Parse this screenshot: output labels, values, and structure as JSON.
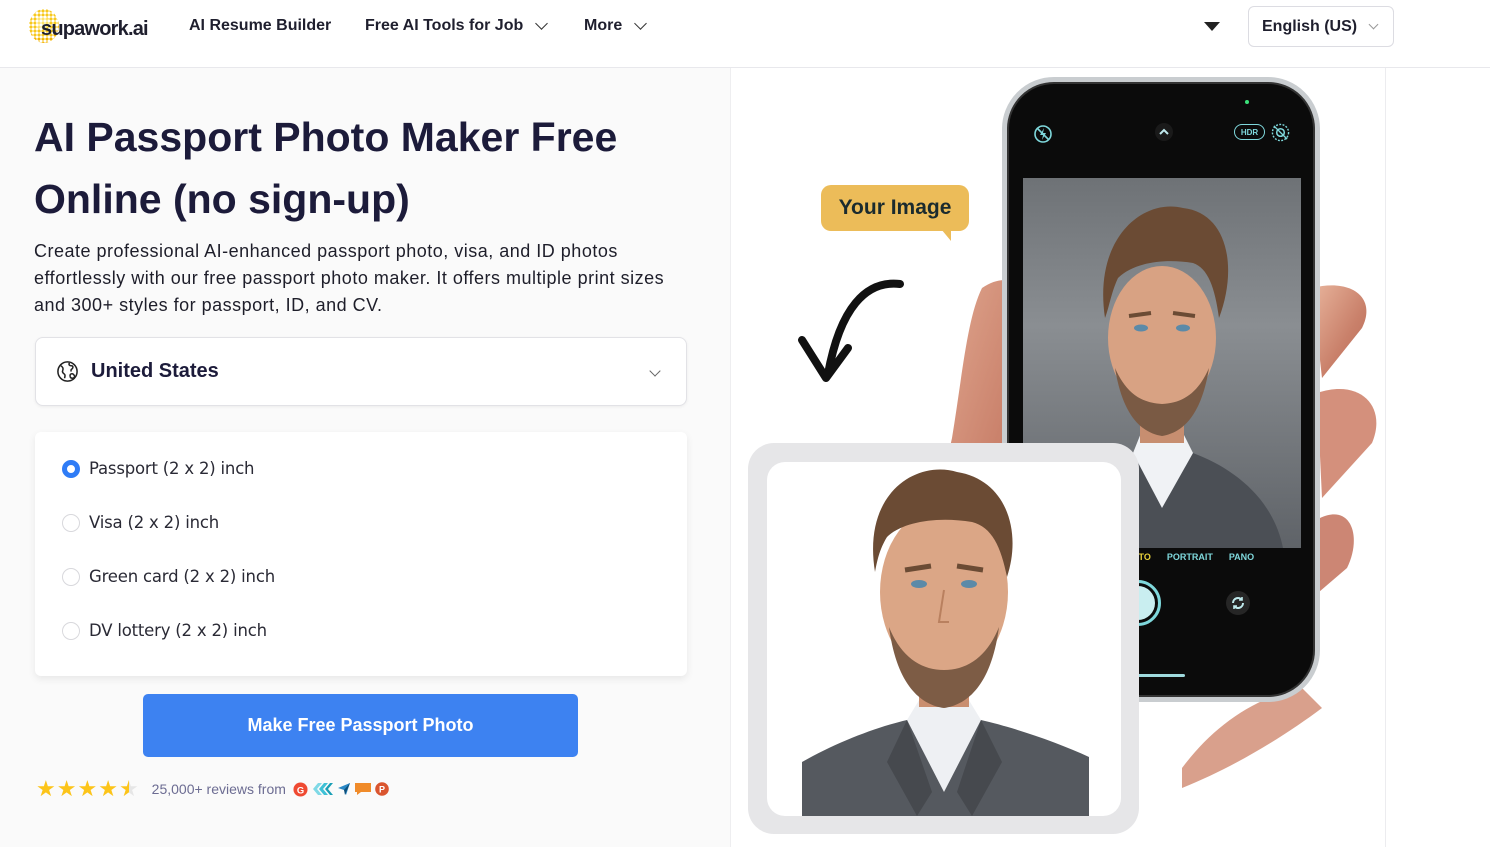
{
  "header": {
    "logo_text": "supawork.ai",
    "nav": [
      {
        "label": "AI Resume Builder",
        "has_dropdown": false
      },
      {
        "label": "Free AI Tools for Job",
        "has_dropdown": true
      },
      {
        "label": "More",
        "has_dropdown": true
      }
    ],
    "language": "English (US)"
  },
  "hero": {
    "title": "AI Passport Photo Maker Free Online (no sign-up)",
    "description": "Create professional AI-enhanced passport photo, visa, and ID photos effortlessly with our free passport photo maker. It offers multiple print sizes and 300+ styles for passport, ID, and CV.",
    "country": "United States",
    "photo_types": [
      {
        "label": "Passport (2 x 2) inch",
        "selected": true
      },
      {
        "label": "Visa (2 x 2) inch",
        "selected": false
      },
      {
        "label": "Green card (2 x 2) inch",
        "selected": false
      },
      {
        "label": "DV lottery (2 x 2) inch",
        "selected": false
      }
    ],
    "cta_label": "Make Free Passport Photo",
    "rating": {
      "stars": 4.5,
      "text": "25,000+ reviews from",
      "sources": [
        "g2-icon",
        "capterra-icon",
        "getapp-icon",
        "software-advice-icon",
        "product-hunt-icon"
      ]
    }
  },
  "illustration": {
    "bubble_text": "Your Image",
    "camera_modes": [
      "PHOTO",
      "PORTRAIT",
      "PANO"
    ],
    "active_mode": "PHOTO",
    "hdr_label": "HDR"
  },
  "colors": {
    "primary": "#3d82f1",
    "radio_active": "#2f7cf6",
    "star": "#fcc419",
    "bubble": "#ecbc59",
    "title": "#1c1b3a"
  }
}
